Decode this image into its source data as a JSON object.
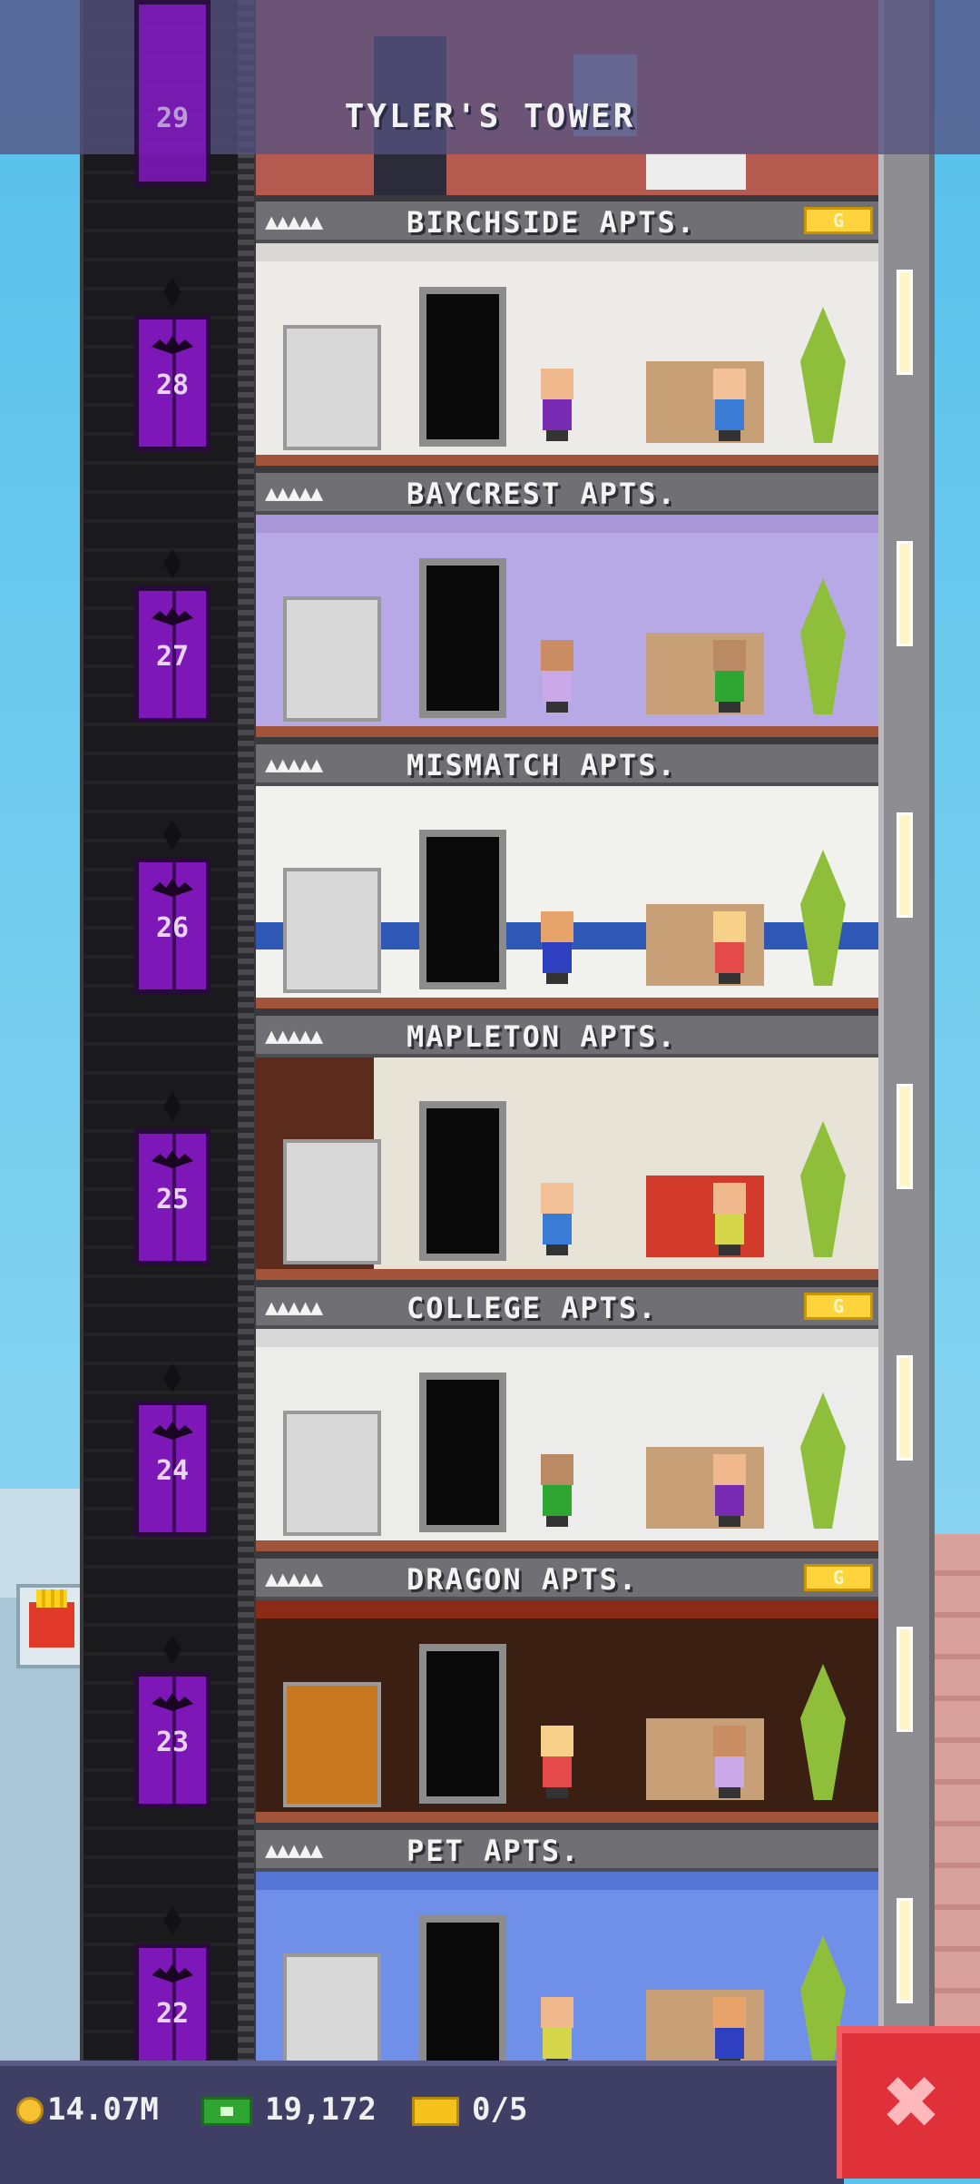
{
  "header": {
    "title": "TYLER'S TOWER",
    "top_floor_number": "29"
  },
  "floors": [
    {
      "number": "28",
      "name": "BIRCHSIDE APTS.",
      "residents": "▲▲▲▲▲",
      "gold_badge": "G",
      "theme": "white"
    },
    {
      "number": "27",
      "name": "BAYCREST APTS.",
      "residents": "▲▲▲▲▲",
      "gold_badge": "",
      "theme": "lavender"
    },
    {
      "number": "26",
      "name": "MISMATCH APTS.",
      "residents": "▲▲▲▲▲",
      "gold_badge": "",
      "theme": "mismatch"
    },
    {
      "number": "25",
      "name": "MAPLETON APTS.",
      "residents": "▲▲▲▲▲",
      "gold_badge": "",
      "theme": "brick"
    },
    {
      "number": "24",
      "name": "COLLEGE APTS.",
      "residents": "▲▲▲▲▲",
      "gold_badge": "G",
      "theme": "college"
    },
    {
      "number": "23",
      "name": "DRAGON APTS.",
      "residents": "▲▲▲▲▲",
      "gold_badge": "G",
      "theme": "dragon"
    },
    {
      "number": "22",
      "name": "PET APTS.",
      "residents": "▲▲▲▲▲",
      "gold_badge": "",
      "theme": "pet"
    }
  ],
  "hud": {
    "coins": "14.07M",
    "tower_bux": "19,172",
    "tickets": "0/5",
    "close_label": "✖"
  },
  "colors": {
    "elevator": "#7d17b8",
    "hud": "#3f3f66",
    "close_button": "#e0303a",
    "gold": "#ffd33b"
  }
}
